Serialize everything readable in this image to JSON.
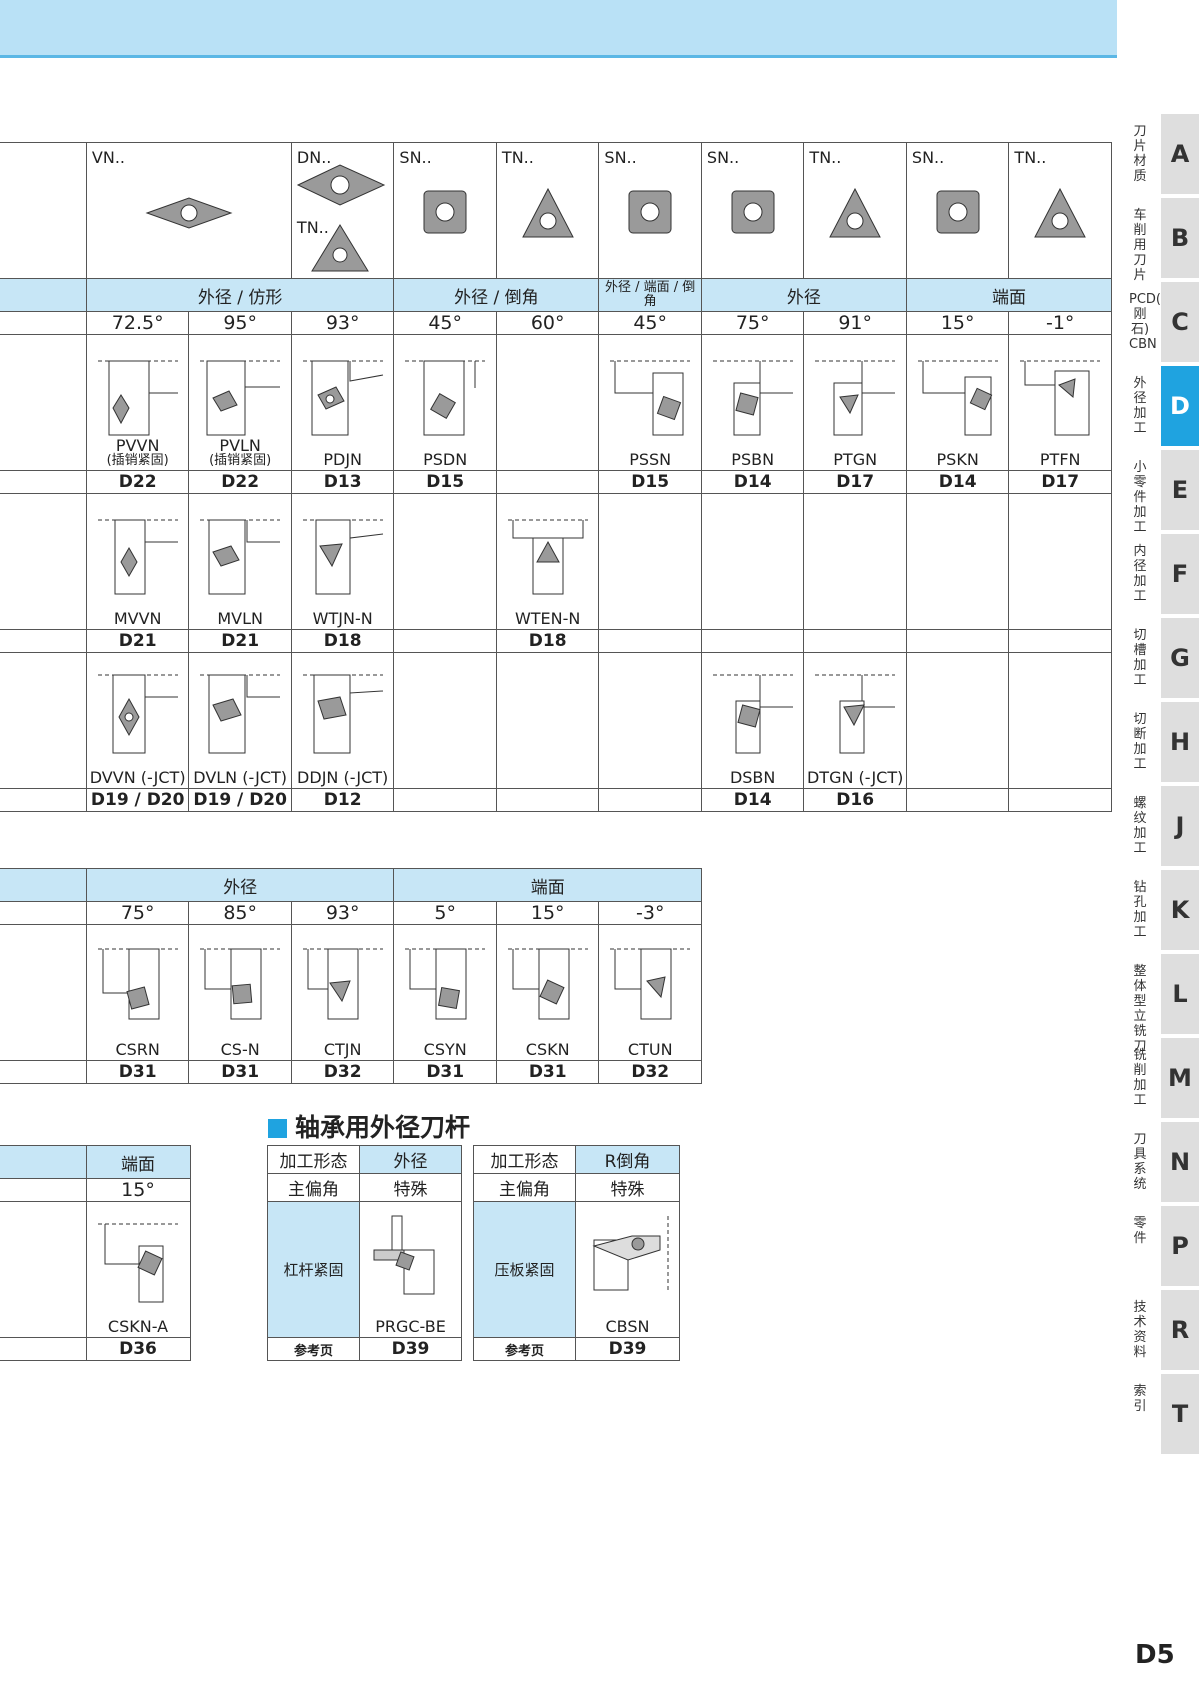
{
  "inserts": {
    "vn": "VN..",
    "dn": "DN..",
    "tn_under": "TN..",
    "c1": "SN..",
    "c2": "TN..",
    "c3": "SN..",
    "c4": "SN..",
    "c5": "TN..",
    "c6": "SN..",
    "c7": "TN.."
  },
  "upper": {
    "groups": [
      "外径 / 仿形",
      "外径 / 倒角",
      "外径 / 端面 / 倒角",
      "外径",
      "端面"
    ],
    "angles": [
      "72.5°",
      "95°",
      "93°",
      "45°",
      "60°",
      "45°",
      "75°",
      "91°",
      "15°",
      "-1°"
    ],
    "row1": [
      {
        "name": "PVVN",
        "sub": "(插销紧固)",
        "page": "D22"
      },
      {
        "name": "PVLN",
        "sub": "(插销紧固)",
        "page": "D22"
      },
      {
        "name": "PDJN",
        "page": "D13"
      },
      {
        "name": "PSDN",
        "page": "D15"
      },
      {
        "name": "",
        "page": ""
      },
      {
        "name": "PSSN",
        "page": "D15"
      },
      {
        "name": "PSBN",
        "page": "D14"
      },
      {
        "name": "PTGN",
        "page": "D17"
      },
      {
        "name": "PSKN",
        "page": "D14"
      },
      {
        "name": "PTFN",
        "page": "D17"
      }
    ],
    "row2": [
      {
        "name": "MVVN",
        "page": "D21"
      },
      {
        "name": "MVLN",
        "page": "D21"
      },
      {
        "name": "WTJN-N",
        "page": "D18"
      },
      {
        "name": "",
        "page": ""
      },
      {
        "name": "WTEN-N",
        "page": "D18"
      }
    ],
    "row3": [
      {
        "name": "DVVN (-JCT)",
        "page": "D19 / D20"
      },
      {
        "name": "DVLN (-JCT)",
        "page": "D19 / D20"
      },
      {
        "name": "DDJN (-JCT)",
        "page": "D12"
      },
      {
        "name": "DSBN",
        "page": "D14"
      },
      {
        "name": "DTGN (-JCT)",
        "page": "D16"
      }
    ]
  },
  "middle": {
    "groups": [
      "外径",
      "端面"
    ],
    "angles": [
      "75°",
      "85°",
      "93°",
      "5°",
      "15°",
      "-3°"
    ],
    "tools": [
      {
        "name": "CSRN",
        "page": "D31"
      },
      {
        "name": "CS-N",
        "page": "D31"
      },
      {
        "name": "CTJN",
        "page": "D32"
      },
      {
        "name": "CSYN",
        "page": "D31"
      },
      {
        "name": "CSKN",
        "page": "D31"
      },
      {
        "name": "CTUN",
        "page": "D32"
      }
    ]
  },
  "lower_left": {
    "group": "端面",
    "angle": "15°",
    "name": "CSKN-A",
    "page": "D36"
  },
  "bearing": {
    "title": "轴承用外径刀杆",
    "t1": {
      "h1": "加工形态",
      "h2": "外径",
      "r1": "主偏角",
      "r2": "特殊",
      "clamp": "杠杆紧固",
      "name": "PRGC-BE",
      "ref": "参考页",
      "page": "D39"
    },
    "t2": {
      "h1": "加工形态",
      "h2": "R倒角",
      "r1": "主偏角",
      "r2": "特殊",
      "clamp": "压板紧固",
      "name": "CBSN",
      "ref": "参考页",
      "page": "D39"
    }
  },
  "side_tabs": [
    {
      "letter": "A",
      "label": "刀片材质"
    },
    {
      "letter": "B",
      "label": "车削用刀片"
    },
    {
      "letter": "C",
      "label": "PCD(金刚石) CBN"
    },
    {
      "letter": "D",
      "label": "外径加工"
    },
    {
      "letter": "E",
      "label": "小零件加工"
    },
    {
      "letter": "F",
      "label": "内径加工"
    },
    {
      "letter": "G",
      "label": "切槽加工"
    },
    {
      "letter": "H",
      "label": "切断加工"
    },
    {
      "letter": "J",
      "label": "螺纹加工"
    },
    {
      "letter": "K",
      "label": "钻孔加工"
    },
    {
      "letter": "L",
      "label": "整体型立铣刀"
    },
    {
      "letter": "M",
      "label": "铣削加工"
    },
    {
      "letter": "N",
      "label": "刀具系统"
    },
    {
      "letter": "P",
      "label": "零件"
    },
    {
      "letter": "R",
      "label": "技术资料"
    },
    {
      "letter": "T",
      "label": "索引"
    }
  ],
  "active_tab": "D",
  "page_number": "D5",
  "colors": {
    "header_fill": "#c7e6f6",
    "accent": "#1fa3e0",
    "topbar": "#b9e1f6"
  }
}
